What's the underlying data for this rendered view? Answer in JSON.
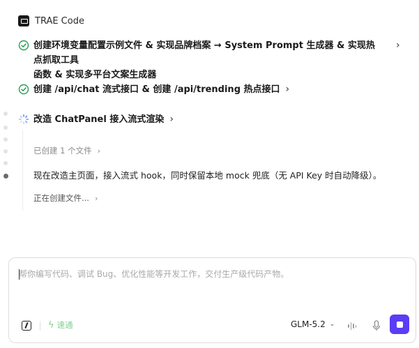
{
  "header": {
    "title": "TRAE Code",
    "logo_icon": "trae-logo-icon"
  },
  "tasks": [
    {
      "status": "done",
      "line1": "创建环境变量配置示例文件 & 实现品牌档案 → System Prompt 生成器 & 实现热点抓取工具",
      "line2": "函数 & 实现多平台文案生成器"
    },
    {
      "status": "done",
      "text": "创建 /api/chat 流式接口 & 创建 /api/trending 热点接口"
    },
    {
      "status": "in-progress",
      "text": "改造 ChatPanel 接入流式渲染"
    }
  ],
  "current_task": {
    "created_files": "已创建 1 个文件",
    "message": "现在改造主页面，接入流式 hook，同时保留本地 mock 兜底（无 API Key 时自动降级）。",
    "creating": "正在创建文件..."
  },
  "composer": {
    "placeholder": "帮你编写代码、调试 Bug、优化性能等开发工作，交付生产级代码产物。",
    "fast_mode_label": "速通",
    "model": "GLM-5.2"
  },
  "colors": {
    "check": "#2a9d57",
    "accent": "#5a3df5",
    "fast_mode": "#7fcf93"
  }
}
